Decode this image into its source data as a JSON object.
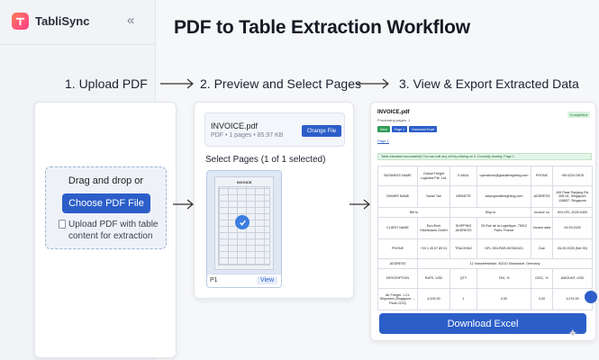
{
  "sidebar": {
    "brand": "TabliSync",
    "collapse_icon": "chevrons-left-icon"
  },
  "page": {
    "title": "PDF to Table Extraction Workflow"
  },
  "steps": [
    {
      "label": "1. Upload PDF"
    },
    {
      "label": "2. Preview and Select Pages"
    },
    {
      "label": "3. View & Export Extracted Data"
    }
  ],
  "upload": {
    "drag_text": "Drag and drop or",
    "button_label": "Choose PDF File",
    "hint": "Upload PDF with table content for extraction"
  },
  "preview": {
    "file_name": "INVOICE.pdf",
    "file_meta": "PDF • 1 pages • 85.97 KB",
    "change_label": "Change File",
    "select_label": "Select Pages (1 of 1 selected)",
    "thumb_title": "INVOICE",
    "page_label": "P1",
    "view_label": "View"
  },
  "result": {
    "title": "INVOICE.pdf",
    "subtitle": "Processing pages: 1",
    "status": "Completed",
    "buttons": [
      "Save",
      "Page 1",
      "Download Excel"
    ],
    "page_tab": "Page 1",
    "notice": "Table extracted successfully! You can edit any cell by clicking on it. Currently viewing: Page 1",
    "download_label": "Download Excel",
    "table": {
      "r1": [
        "BUSINESS NAME",
        "Global Freight Logistics Pte. Ltd.",
        "E-MAIL",
        "operations@globalfreightlog.com",
        "PHONE",
        "+65 6234 5678"
      ],
      "r2": [
        "OWNER NAME",
        "Sarah Tan",
        "WEBSITE",
        "www.globalfreightlog.com",
        "ADDRESS",
        "100 Pasir Panjang Rd, #05-01, Singapore 118857, Singapore"
      ],
      "r3": [
        "Bill to",
        "Ship to",
        "Invoice no",
        "INV-GFL-2025-0409"
      ],
      "r4": [
        "CLIENT NAME",
        "EuroTech Distributors GmbH",
        "SHIPPING ADDRESS",
        "25 Rue de la Logistique, 75012 Paris, France",
        "Invoice date",
        "04.09.2025"
      ],
      "r5": [
        "PHONE",
        "+33 1 45 67 89 01",
        "TRACKING",
        "GFL-SIN-PAR-987654321",
        "Due",
        "05.09.2025 (Net 30)"
      ],
      "r6": [
        "ADDRESS",
        "12 Industriestraße, 40210 Düsseldorf, Germany"
      ],
      "r7": [
        "DESCRIPTION",
        "RATE, USD",
        "QTY",
        "TAX, %",
        "DISC, %",
        "AMOUNT, USD"
      ],
      "r8": [
        "Air Freight - LCL Shipment (Singapore → Paris CDG)",
        "4,200.00",
        "1",
        "0.00",
        "3.00",
        "4,074.00"
      ]
    }
  }
}
